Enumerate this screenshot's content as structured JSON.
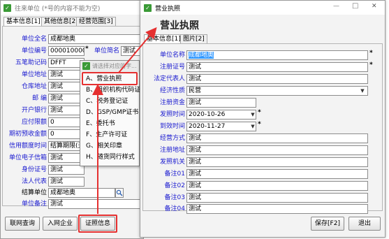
{
  "colors": {
    "accent_red": "#e53030",
    "label_blue": "#1a1ad0",
    "selection": "#3399ff"
  },
  "back_window": {
    "title": "往来单位 (*号的内容不能为空)",
    "tabs": [
      "基本信息[1]",
      "其他信息[2]",
      "经营范围[3]"
    ],
    "fields": {
      "unit_fullname_label": "单位全名",
      "unit_fullname": "成都地奥",
      "unit_code_label": "单位编号",
      "unit_code": "0000100001",
      "unit_short_label": "单位简名",
      "unit_short": "测试",
      "wubi_label": "五笔助记码",
      "wubi": "DFFT",
      "address_label": "单位地址",
      "address": "测试",
      "warehouse_label": "仓库地址",
      "warehouse": "测试",
      "postcode_label": "邮    编",
      "postcode": "测试",
      "bank_label": "开户银行",
      "bank": "测试",
      "payable_days_label": "应付限额",
      "payable_days": "0",
      "initial_prepaid_label": "期初预收金额",
      "initial_prepaid": "0",
      "credit_label": "信用额度时间",
      "credit": "结算期限(天)",
      "email_label": "单位电子信箱",
      "email": "测试",
      "idcard_label": "身份证号",
      "idcard": "测试",
      "legal_label": "法人代表",
      "legal": "测试",
      "settle_label": "结算单位",
      "settle": "成都地奥",
      "remark_label": "单位备注",
      "remark": "测试"
    },
    "buttons": [
      "联网查询",
      "入网企业",
      "证照信息"
    ],
    "popup": {
      "title": "请选择对应的字...",
      "items": [
        {
          "key": "A",
          "label": "营业执照"
        },
        {
          "key": "B",
          "label": "组织机构代码证"
        },
        {
          "key": "C",
          "label": "税务登记证"
        },
        {
          "key": "D",
          "label": "GSP/GMP证书"
        },
        {
          "key": "E",
          "label": "委托书"
        },
        {
          "key": "F",
          "label": "生产许可证"
        },
        {
          "key": "G",
          "label": "相关印章"
        },
        {
          "key": "H",
          "label": "随货同行样式"
        }
      ]
    }
  },
  "front_window": {
    "title": "营业执照",
    "minimize": "—",
    "maximize": "□",
    "close": "✕",
    "tabs": [
      "基本信息[1]",
      "图片[2]"
    ],
    "heading": "营业执照",
    "fields": [
      {
        "label": "单位名称",
        "value": "成都地奥",
        "required": "*",
        "selected": true
      },
      {
        "label": "注册证号",
        "value": "测试",
        "required": "*"
      },
      {
        "label": "法定代表人",
        "value": "测试"
      },
      {
        "label": "经济性质",
        "value": "民营",
        "combo": true
      },
      {
        "label": "注册资金",
        "value": "测试"
      },
      {
        "label": "发照时间",
        "value": "2020-10-26",
        "date": true,
        "required": "*"
      },
      {
        "label": "到效时间",
        "value": "2020-11-27",
        "date": true,
        "required": "*"
      },
      {
        "label": "经营方式",
        "value": "测试"
      },
      {
        "label": "注册地址",
        "value": "测试"
      },
      {
        "label": "发照机关",
        "value": "测试"
      },
      {
        "label": "备注01",
        "value": "测试"
      },
      {
        "label": "备注02",
        "value": "测试"
      },
      {
        "label": "备注03",
        "value": "测试"
      },
      {
        "label": "备注04",
        "value": "测试"
      }
    ],
    "save_label": "保存[F2]",
    "exit_label": "退出"
  }
}
